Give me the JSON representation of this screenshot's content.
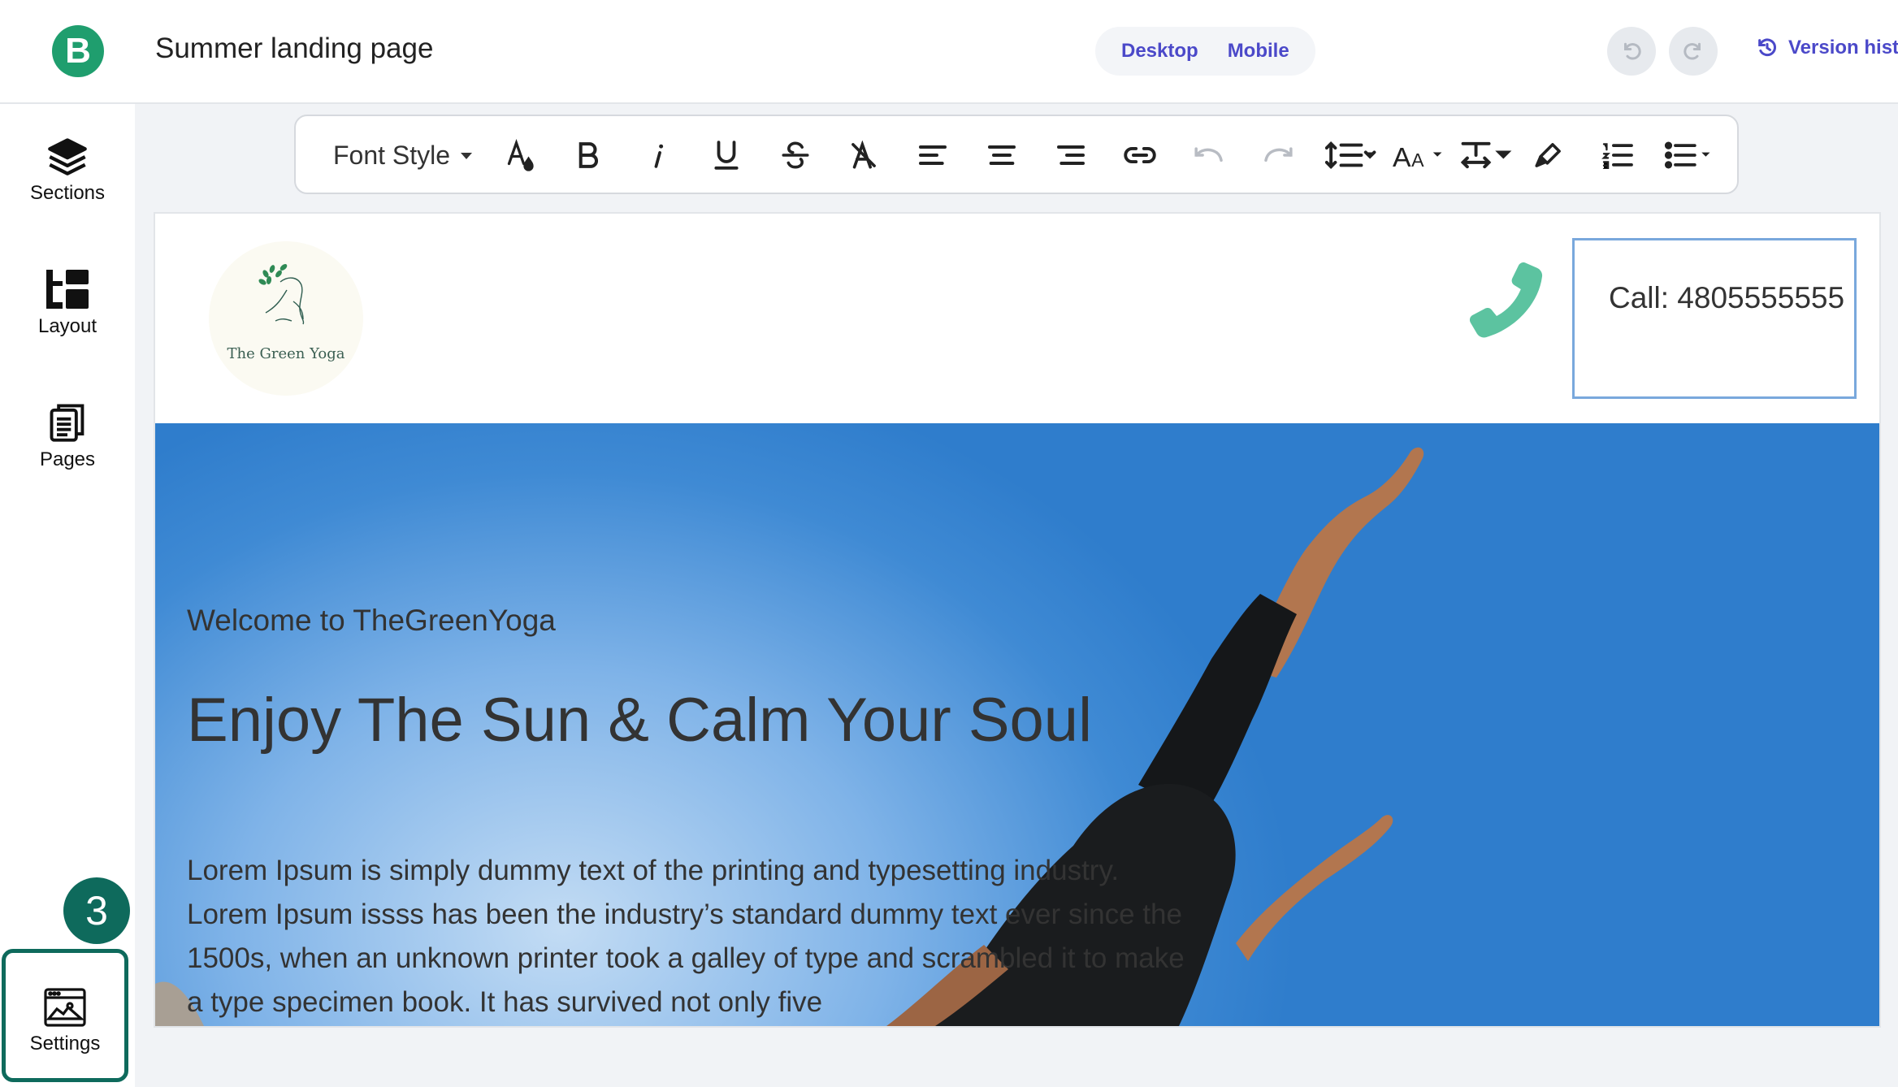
{
  "app": {
    "page_title": "Summer landing page",
    "device_toggle": {
      "desktop_label": "Desktop",
      "mobile_label": "Mobile",
      "selected": "Desktop"
    },
    "version_history_label": "Version hist",
    "accent_color": "#4b49c9",
    "brand_color": "#1f9e6e"
  },
  "sidebar": {
    "items": [
      {
        "label": "Sections",
        "icon": "layers-icon"
      },
      {
        "label": "Layout",
        "icon": "layout-icon"
      },
      {
        "label": "Pages",
        "icon": "pages-icon"
      },
      {
        "label": "Settings",
        "icon": "browser-settings-icon"
      }
    ],
    "step_badge": "3",
    "highlight_color": "#0e6a5c"
  },
  "toolbar": {
    "font_style_label": "Font Style",
    "icons": [
      "text-color-icon",
      "bold-icon",
      "italic-icon",
      "underline-icon",
      "strikethrough-icon",
      "clear-format-icon",
      "align-left-icon",
      "align-center-icon",
      "align-right-icon",
      "link-icon",
      "undo-icon",
      "redo-icon",
      "line-height-icon",
      "font-size-icon",
      "text-spacing-icon",
      "highlight-icon",
      "numbered-list-icon",
      "bullet-list-icon"
    ]
  },
  "site": {
    "logo_text": "The Green Yoga",
    "call_text": "Call: 4805555555",
    "phone_color": "#5cc3a0",
    "hero": {
      "subtitle": "Welcome to TheGreenYoga",
      "title": "Enjoy The Sun & Calm Your Soul",
      "body": "Lorem Ipsum is simply dummy text of the printing and typesetting industry. Lorem Ipsum issss has been the industry’s standard dummy text ever since the 1500s, when an unknown printer took a galley of type and scrambled it to make a type specimen book. It has survived not only five"
    }
  }
}
